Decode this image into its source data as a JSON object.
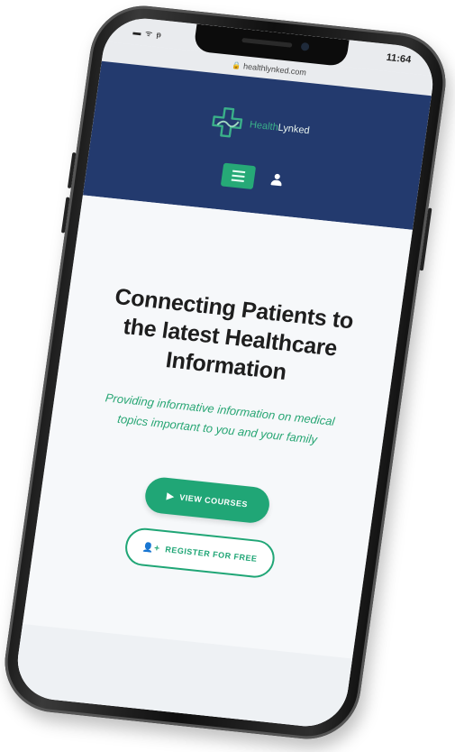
{
  "status_bar": {
    "time": "11:64",
    "icons": "▬ ᯤ ᵽ"
  },
  "browser": {
    "url": "healthlynked.com"
  },
  "header": {
    "logo_text_primary": "Health",
    "logo_text_secondary": "Lynked"
  },
  "hero": {
    "title_line1": "Connecting Patients to",
    "title_line2": "the latest Healthcare",
    "title_line3": "Information",
    "subtitle_line1": "Providing informative information on medical",
    "subtitle_line2": "topics important to you and your family",
    "view_courses_label": "VIEW COURSES",
    "register_label": "REGISTER FOR FREE"
  },
  "colors": {
    "header_bg": "#233a6e",
    "accent_green": "#20a676",
    "page_bg": "#f6f8fa"
  },
  "icons": {
    "menu": "hamburger-menu-icon",
    "user": "user-icon",
    "courses": "play-icon",
    "register": "add-user-icon",
    "logo": "medical-cross-logo-icon",
    "lock": "lock-icon"
  }
}
